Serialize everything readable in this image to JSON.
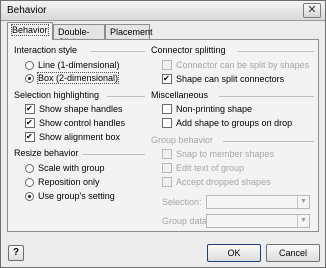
{
  "window": {
    "title": "Behavior",
    "close_glyph": "✕"
  },
  "tabs": [
    {
      "label": "Behavior",
      "active": true
    },
    {
      "label": "Double-Click",
      "active": false
    },
    {
      "label": "Placement",
      "active": false
    }
  ],
  "interaction_style": {
    "label": "Interaction style",
    "options": [
      {
        "label": "Line (1-dimensional)",
        "checked": false
      },
      {
        "label": "Box (2-dimensional)",
        "checked": true
      }
    ]
  },
  "selection_highlighting": {
    "label": "Selection highlighting",
    "options": [
      {
        "label": "Show shape handles",
        "checked": true
      },
      {
        "label": "Show control handles",
        "checked": true
      },
      {
        "label": "Show alignment box",
        "checked": true
      }
    ]
  },
  "resize_behavior": {
    "label": "Resize behavior",
    "options": [
      {
        "label": "Scale with group",
        "checked": false
      },
      {
        "label": "Reposition only",
        "checked": false
      },
      {
        "label": "Use group's setting",
        "checked": true
      }
    ]
  },
  "connector_splitting": {
    "label": "Connector splitting",
    "options": [
      {
        "label": "Connector can be split by shapes",
        "checked": false,
        "disabled": true
      },
      {
        "label": "Shape can split connectors",
        "checked": true,
        "disabled": false
      }
    ]
  },
  "miscellaneous": {
    "label": "Miscellaneous",
    "options": [
      {
        "label": "Non-printing shape",
        "checked": false
      },
      {
        "label": "Add shape to groups on drop",
        "checked": false
      }
    ]
  },
  "group_behavior": {
    "label": "Group behavior",
    "options": [
      {
        "label": "Snap to member shapes",
        "checked": false
      },
      {
        "label": "Edit text of group",
        "checked": false
      },
      {
        "label": "Accept dropped shapes",
        "checked": false
      }
    ],
    "selection_label": "Selection:",
    "group_data_label": "Group data:"
  },
  "footer": {
    "ok_label": "OK",
    "cancel_label": "Cancel",
    "help_glyph": "?"
  }
}
